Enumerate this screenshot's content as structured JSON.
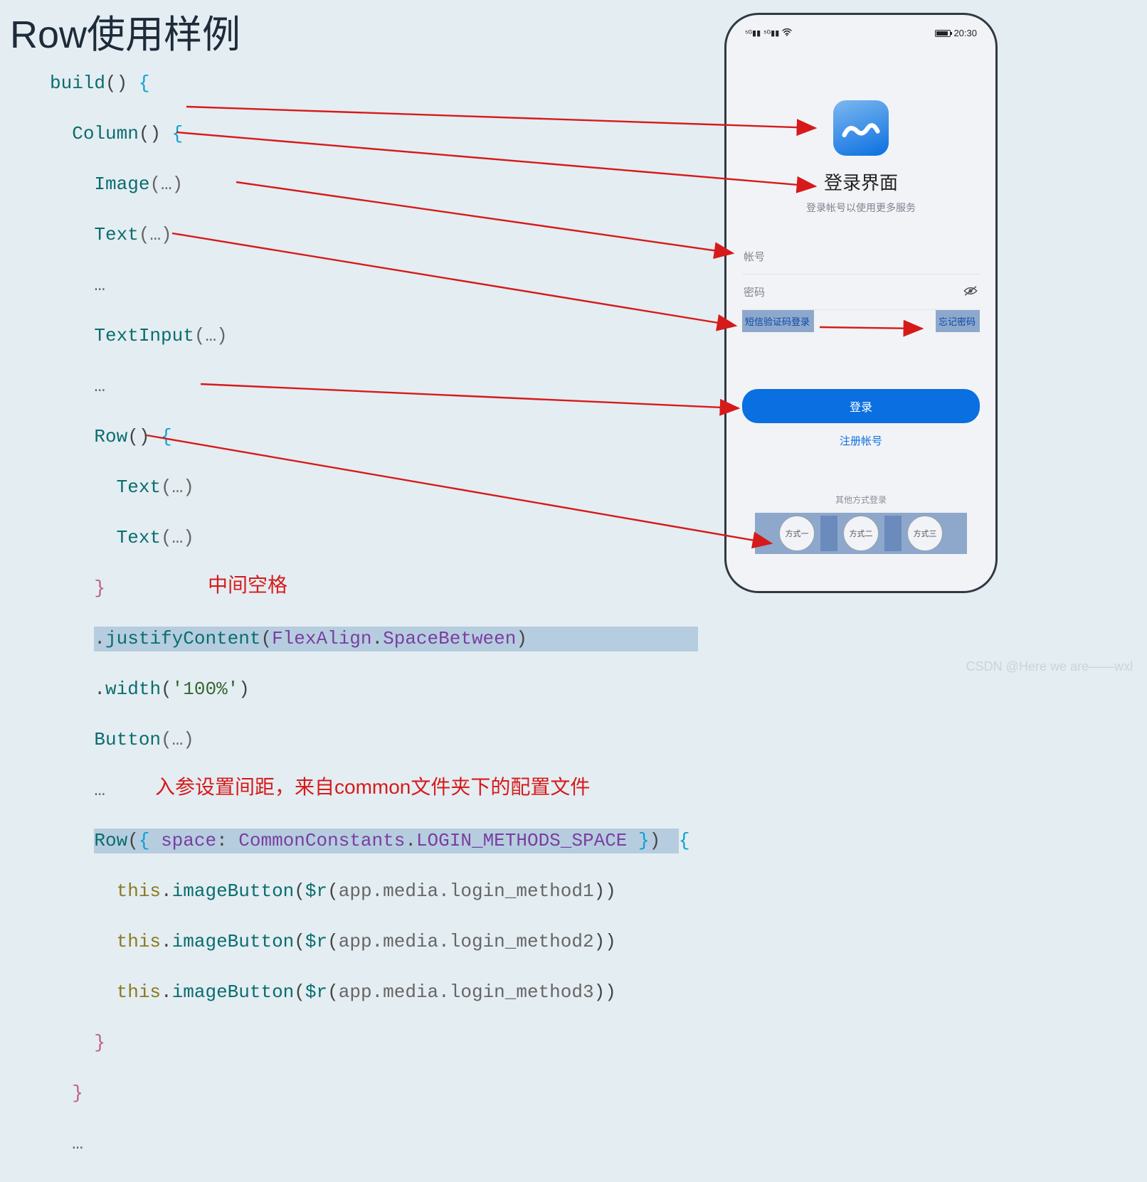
{
  "title": "Row使用样例",
  "annotations": {
    "space_label": "中间空格",
    "param_label": "入参设置间距，来自common文件夹下的配置文件"
  },
  "code": {
    "l1_func": "build",
    "l1_rest": "() ",
    "l2_func": "Column",
    "l2_rest": "() ",
    "l3_func": "Image",
    "l3_rest": "(…)",
    "l4_func": "Text",
    "l4_rest": "(…)",
    "l5": "…",
    "l6_func": "TextInput",
    "l6_rest": "(…)",
    "l7": "…",
    "l8_func": "Row",
    "l8_rest": "() ",
    "l9_func": "Text",
    "l9_rest": "(…)",
    "l10_func": "Text",
    "l10_rest": "(…)",
    "l12_a": ".",
    "l12_func": "justifyContent",
    "l12_b": "(",
    "l12_c": "FlexAlign",
    "l12_d": ".",
    "l12_e": "SpaceBetween",
    "l12_f": ")",
    "l13_a": ".",
    "l13_func": "width",
    "l13_b": "(",
    "l13_str": "'100%'",
    "l13_c": ")",
    "l14_func": "Button",
    "l14_rest": "(…)",
    "l15": "…",
    "l16_func": "Row",
    "l16_a": "(",
    "l16_b": "{ ",
    "l16_key": "space",
    "l16_c": ": ",
    "l16_val": "CommonConstants",
    "l16_d": ".",
    "l16_val2": "LOGIN_METHODS_SPACE",
    "l16_e": " }",
    "l16_f": ") ",
    "l17_this": "this",
    "l17_a": ".",
    "l17_m": "imageButton",
    "l17_b": "(",
    "l17_r": "$r",
    "l17_c": "(",
    "l17_arg": "app.media.login_method1",
    "l17_d": "))",
    "l18_this": "this",
    "l18_a": ".",
    "l18_m": "imageButton",
    "l18_b": "(",
    "l18_r": "$r",
    "l18_c": "(",
    "l18_arg": "app.media.login_method2",
    "l18_d": "))",
    "l19_this": "this",
    "l19_a": ".",
    "l19_m": "imageButton",
    "l19_b": "(",
    "l19_r": "$r",
    "l19_c": "(",
    "l19_arg": "app.media.login_method3",
    "l19_d": "))",
    "l22": "…"
  },
  "phone": {
    "time": "20:30",
    "login_title": "登录界面",
    "login_sub": "登录帐号以使用更多服务",
    "field_account": "帐号",
    "field_password": "密码",
    "sms_login": "短信验证码登录",
    "forgot": "忘记密码",
    "login_button": "登录",
    "register": "注册帐号",
    "other_title": "其他方式登录",
    "method1": "方式一",
    "method2": "方式二",
    "method3": "方式三"
  },
  "watermark": "CSDN @Here we are——wxl"
}
